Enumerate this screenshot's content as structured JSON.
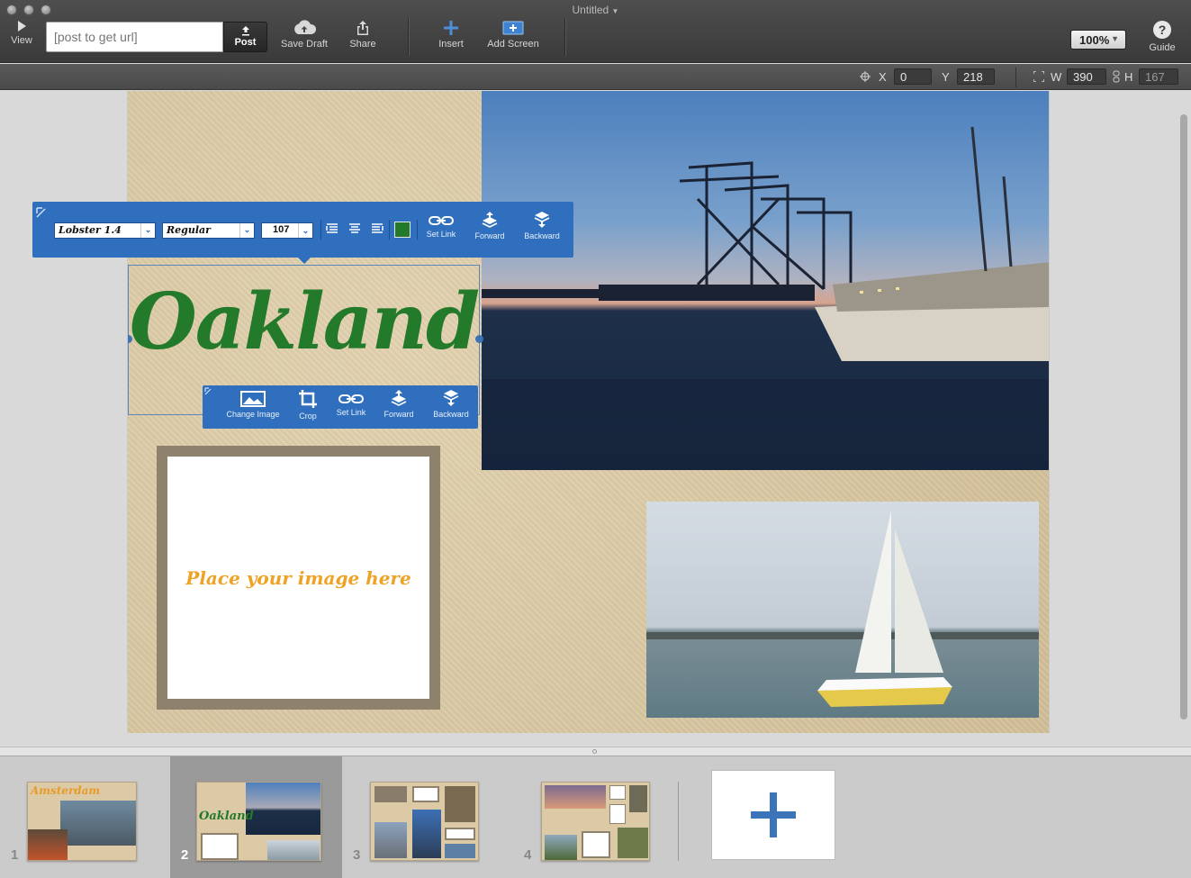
{
  "window": {
    "title": "Untitled"
  },
  "toolbar": {
    "view_label": "View",
    "url_placeholder": "[post to get url]",
    "post_label": "Post",
    "save_draft_label": "Save Draft",
    "share_label": "Share",
    "insert_label": "Insert",
    "add_screen_label": "Add Screen",
    "zoom_value": "100%",
    "guide_label": "Guide"
  },
  "coords": {
    "x_label": "X",
    "x_value": "0",
    "y_label": "Y",
    "y_value": "218",
    "w_label": "W",
    "w_value": "390",
    "h_label": "H",
    "h_value": "167"
  },
  "text_toolbar": {
    "font_family": "Lobster 1.4",
    "font_style": "Regular",
    "font_size": "107",
    "text_color": "#237a2a",
    "set_link_label": "Set Link",
    "forward_label": "Forward",
    "backward_label": "Backward"
  },
  "image_toolbar": {
    "change_image_label": "Change Image",
    "crop_label": "Crop",
    "set_link_label": "Set Link",
    "forward_label": "Forward",
    "backward_label": "Backward"
  },
  "page": {
    "title": "Oakland",
    "placeholder_text": "Place your image here"
  },
  "filmstrip": {
    "slides": [
      {
        "number": "1",
        "title": "Amsterdam"
      },
      {
        "number": "2",
        "title": "Oakland"
      },
      {
        "number": "3"
      },
      {
        "number": "4"
      }
    ],
    "selected": "2"
  },
  "colors": {
    "accent": "#2f6fbd",
    "title_green": "#237a2a",
    "placeholder_orange": "#efa223"
  }
}
